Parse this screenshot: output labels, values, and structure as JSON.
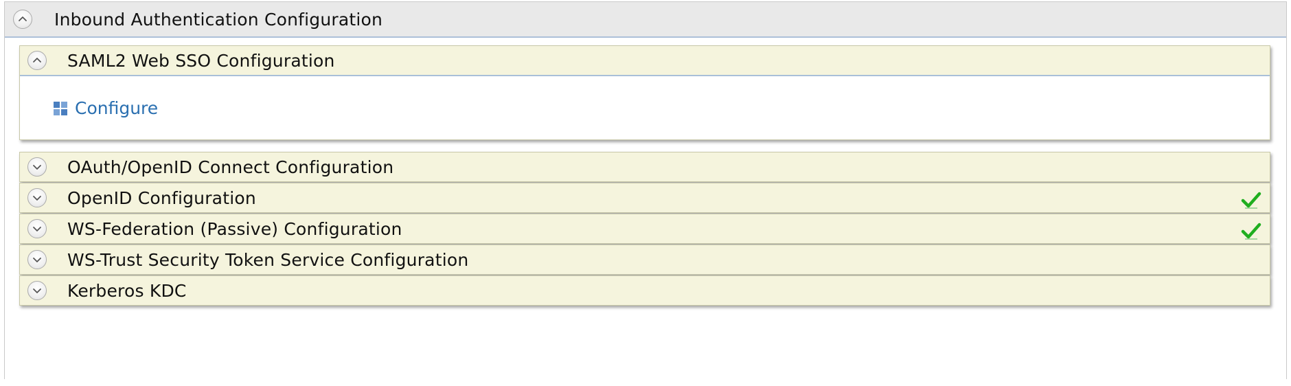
{
  "outer_panel": {
    "title": "Inbound Authentication Configuration",
    "state": "expanded"
  },
  "sections": [
    {
      "title": "SAML2 Web SSO Configuration",
      "state": "expanded",
      "configured": false,
      "body": {
        "link_icon": "grid-icon",
        "link_label": "Configure"
      }
    },
    {
      "title": "OAuth/OpenID Connect Configuration",
      "state": "collapsed",
      "configured": false
    },
    {
      "title": "OpenID Configuration",
      "state": "collapsed",
      "configured": true
    },
    {
      "title": "WS-Federation (Passive) Configuration",
      "state": "collapsed",
      "configured": true
    },
    {
      "title": "WS-Trust Security Token Service Configuration",
      "state": "collapsed",
      "configured": false
    },
    {
      "title": "Kerberos KDC",
      "state": "collapsed",
      "configured": false
    }
  ],
  "icons": {
    "expanded_toggle": "chevron-up-icon",
    "collapsed_toggle": "chevron-down-icon",
    "configured_marker": "checkmark-icon"
  },
  "colors": {
    "section_bg": "#f5f4dd",
    "link": "#2a6fb0",
    "check": "#1fae1f"
  }
}
